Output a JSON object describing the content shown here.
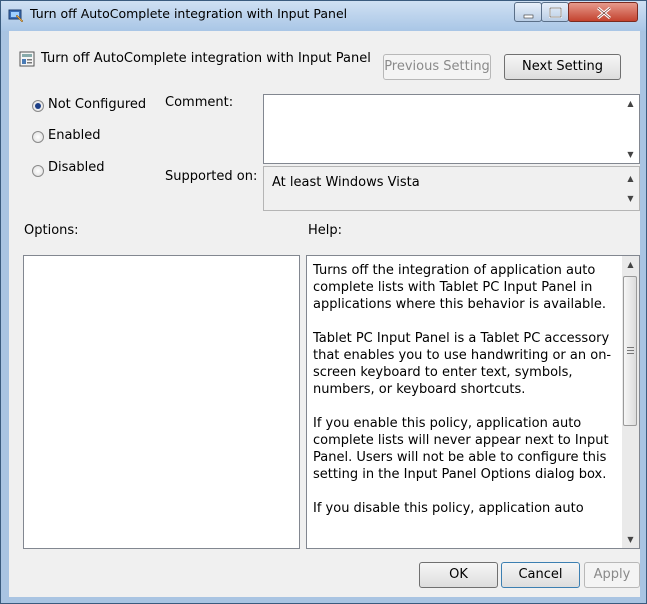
{
  "window": {
    "title": "Turn off AutoComplete integration with Input Panel"
  },
  "header": {
    "setting_name": "Turn off AutoComplete integration with Input Panel",
    "previous_label": "Previous Setting",
    "next_label": "Next Setting"
  },
  "state": {
    "options": [
      "Not Configured",
      "Enabled",
      "Disabled"
    ],
    "selected": "Not Configured"
  },
  "comment": {
    "label": "Comment:",
    "value": ""
  },
  "supported": {
    "label": "Supported on:",
    "value": "At least Windows Vista"
  },
  "options_label": "Options:",
  "help": {
    "label": "Help:",
    "paragraphs": [
      "Turns off the integration of application auto complete lists with Tablet PC Input Panel in applications where this behavior is available.",
      "Tablet PC Input Panel is a Tablet PC accessory that enables you to use handwriting or an on-screen keyboard to enter text, symbols, numbers, or keyboard shortcuts.",
      "If you enable this policy, application auto complete lists will never appear next to Input Panel. Users will not be able to configure this setting in the Input Panel Options dialog box.",
      "If you disable this policy, application auto"
    ]
  },
  "footer": {
    "ok_label": "OK",
    "cancel_label": "Cancel",
    "apply_label": "Apply"
  },
  "icons": {
    "app": "tablet-pc-icon",
    "setting": "policy-setting-icon"
  }
}
